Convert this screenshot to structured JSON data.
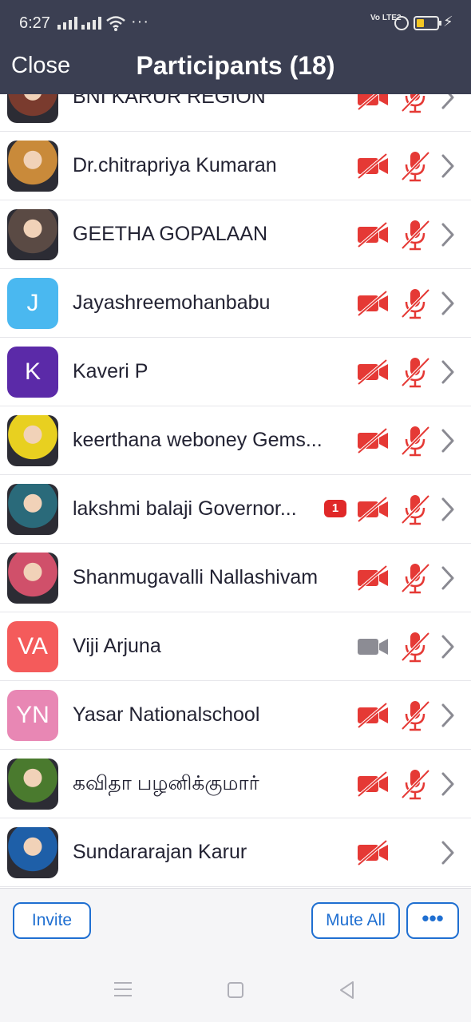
{
  "status_bar": {
    "time": "6:27",
    "dots": "···",
    "volte": "Vo LTE2",
    "icons": [
      "signal-icon",
      "signal-icon",
      "wifi-icon",
      "alarm-icon",
      "battery-icon",
      "charging-icon"
    ]
  },
  "header": {
    "close_label": "Close",
    "title": "Participants (18)"
  },
  "participants": [
    {
      "name": "BNI KARUR REGION",
      "avatar_type": "photo",
      "avatar_color": "#7a3b2e",
      "video": "off",
      "mic": "muted"
    },
    {
      "name": "Dr.chitrapriya Kumaran",
      "avatar_type": "photo",
      "avatar_color": "#c98a3a",
      "video": "off",
      "mic": "muted"
    },
    {
      "name": "GEETHA GOPALAAN",
      "avatar_type": "photo",
      "avatar_color": "#5a4a44",
      "video": "off",
      "mic": "muted"
    },
    {
      "name": "Jayashreemohanbabu",
      "avatar_type": "initials",
      "initials": "J",
      "avatar_color": "#4ab8f0",
      "video": "off",
      "mic": "muted"
    },
    {
      "name": "Kaveri P",
      "avatar_type": "initials",
      "initials": "K",
      "avatar_color": "#5b2aa8",
      "video": "off",
      "mic": "muted"
    },
    {
      "name": "keerthana weboney Gems...",
      "avatar_type": "photo",
      "avatar_color": "#e8d020",
      "video": "off",
      "mic": "muted"
    },
    {
      "name": "lakshmi balaji Governor...",
      "avatar_type": "photo",
      "avatar_color": "#2a6a7a",
      "video": "off",
      "mic": "muted",
      "badge": "1"
    },
    {
      "name": "Shanmugavalli Nallashivam",
      "avatar_type": "photo",
      "avatar_color": "#d0506a",
      "video": "off",
      "mic": "muted"
    },
    {
      "name": "Viji Arjuna",
      "avatar_type": "initials",
      "initials": "VA",
      "avatar_color": "#f45b5b",
      "video": "on",
      "mic": "muted"
    },
    {
      "name": "Yasar Nationalschool",
      "avatar_type": "initials",
      "initials": "YN",
      "avatar_color": "#e887b4",
      "video": "off",
      "mic": "muted"
    },
    {
      "name": "கவிதா பழனிக்குமார்",
      "avatar_type": "photo",
      "avatar_color": "#4a7a2e",
      "video": "off",
      "mic": "muted"
    },
    {
      "name": "Sundararajan Karur",
      "avatar_type": "photo",
      "avatar_color": "#1e5fa8",
      "video": "off",
      "mic": "none"
    }
  ],
  "footer": {
    "invite_label": "Invite",
    "mute_all_label": "Mute All",
    "more_label": "•••"
  },
  "colors": {
    "header_bg": "#3b3f52",
    "muted_red": "#e53935",
    "accent_blue": "#1f6fd1",
    "video_on_gray": "#8c8c94"
  }
}
